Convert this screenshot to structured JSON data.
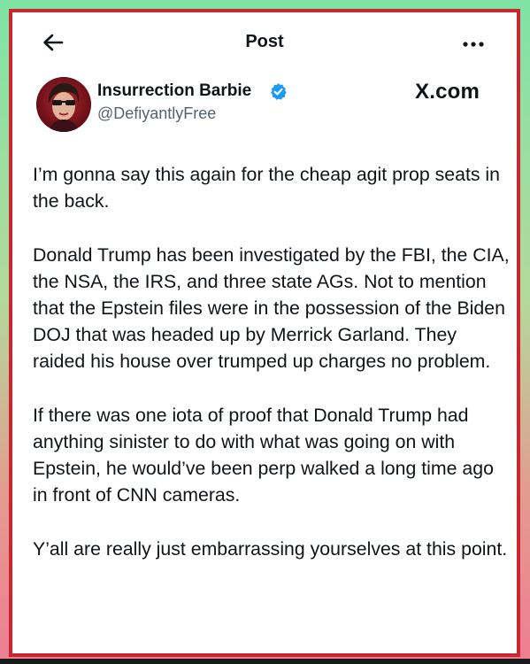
{
  "header": {
    "title": "Post",
    "back_icon": "arrow-left-icon",
    "more_icon": "ellipsis-horizontal-icon"
  },
  "author": {
    "name": "Insurrection Barbie",
    "handle": "@DefiyantlyFree",
    "verified": true,
    "verified_color": "#1d9bf0"
  },
  "source": {
    "label": "X.com"
  },
  "post": {
    "paragraphs": [
      "I’m gonna say this again for the cheap agit prop seats in the back.",
      "Donald Trump has been investigated by the FBI, the CIA, the NSA, the IRS, and three state AGs. Not to mention that the Epstein files were in the possession of the Biden DOJ that was headed up by Merrick Garland. They raided his house over trumped up charges no problem.",
      "If there was one iota of proof that Donald Trump had anything sinister to do with what was going on with Epstein, he would’ve been perp walked a long time ago in front of CNN cameras.",
      "Y’all are really just embarrassing yourselves at this point."
    ]
  },
  "colors": {
    "frame_border": "#c9262f",
    "background_top": "#7fe3a6",
    "background_bottom": "#ee7d92"
  }
}
